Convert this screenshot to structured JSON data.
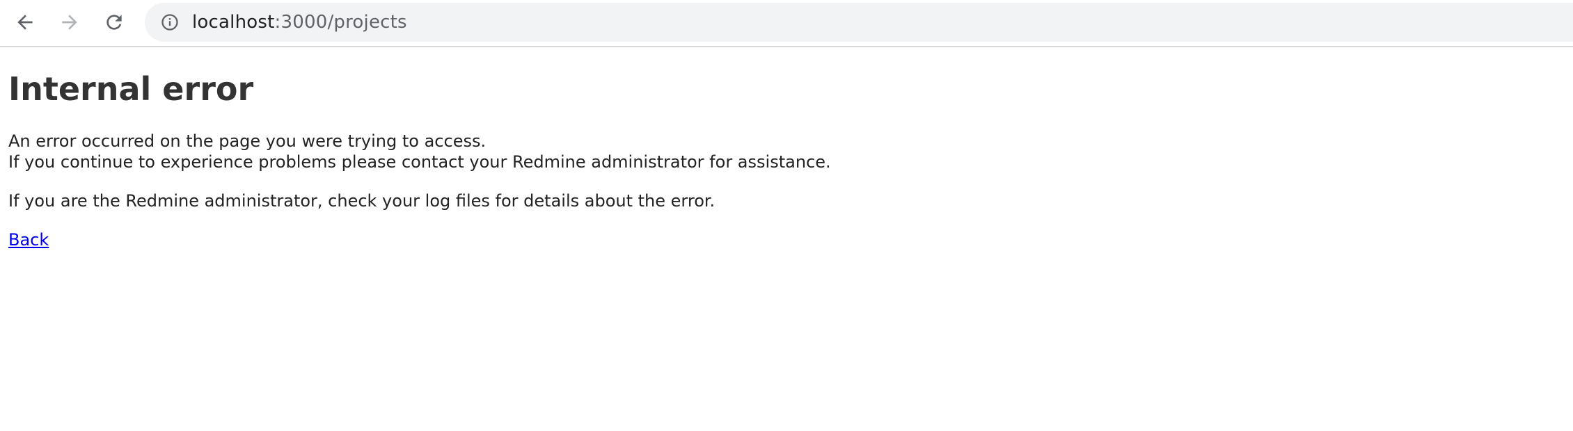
{
  "browser": {
    "url_host": "localhost",
    "url_path": ":3000/projects",
    "icons": {
      "back": "arrow-left-icon",
      "forward": "arrow-right-icon",
      "reload": "reload-icon",
      "info": "info-icon"
    },
    "forward_enabled": false
  },
  "page": {
    "title": "Internal error",
    "line1": "An error occurred on the page you were trying to access.",
    "line2": "If you continue to experience problems please contact your Redmine administrator for assistance.",
    "line3": "If you are the Redmine administrator, check your log files for details about the error.",
    "back_link": "Back"
  },
  "colors": {
    "link": "#0000ee",
    "text": "#222222",
    "omnibox_bg": "#f1f3f4"
  }
}
